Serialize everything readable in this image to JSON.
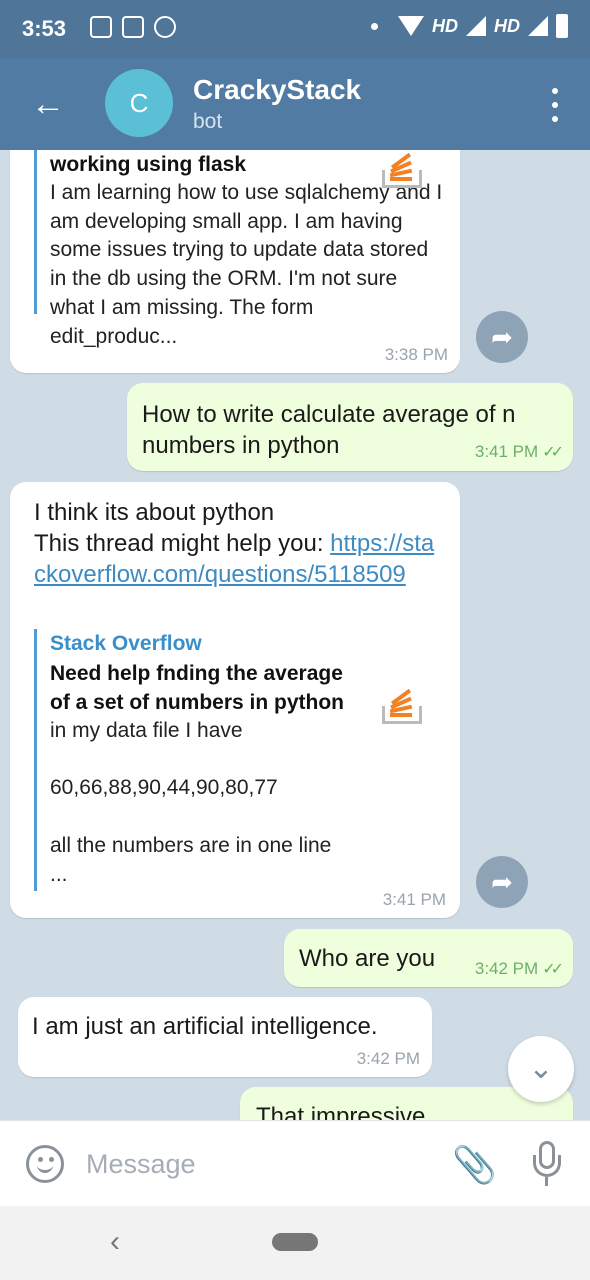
{
  "status_bar": {
    "time": "3:53",
    "network_label_1": "HD",
    "network_label_2": "HD"
  },
  "header": {
    "avatar_letter": "C",
    "title": "CrackyStack",
    "subtitle": "bot"
  },
  "messages": [
    {
      "direction": "in",
      "link_preview": {
        "title": "working using flask",
        "body": "I am learning how to use sqlalchemy and I am developing small app. I am having some issues trying to update data stored in the db using the ORM. I'm not sure what I am missing. The form edit_produc..."
      },
      "time": "3:38 PM"
    },
    {
      "direction": "out",
      "text": "How to write calculate average of n numbers in python",
      "time": "3:41 PM"
    },
    {
      "direction": "in",
      "text_line1": "I think its about python",
      "text_line2": "This thread might help you: ",
      "link": "https://stackoverflow.com/questions/5118509",
      "link_preview": {
        "site": "Stack Overflow",
        "title": "Need help fnding the average of a set of numbers in python",
        "body": "in my data file I have\n\n60,66,88,90,44,90,80,77\n\nall the numbers are in one line\n..."
      },
      "time": "3:41 PM"
    },
    {
      "direction": "out",
      "text": "Who are you",
      "time": "3:42 PM"
    },
    {
      "direction": "in",
      "text": "I am just an artificial intelligence.",
      "time": "3:42 PM"
    },
    {
      "direction": "out",
      "text": "That impressive"
    }
  ],
  "input": {
    "placeholder": "Message"
  },
  "colors": {
    "app_bar": "#527ba3",
    "outgoing_bubble": "#effedd",
    "incoming_bubble": "#ffffff",
    "link": "#3e8bc4",
    "stackoverflow_orange": "#f48024"
  },
  "icons": [
    "back-arrow-icon",
    "more-vert-icon",
    "share-icon",
    "chevron-down-icon",
    "emoji-icon",
    "paperclip-icon",
    "mic-icon",
    "double-check-icon"
  ]
}
